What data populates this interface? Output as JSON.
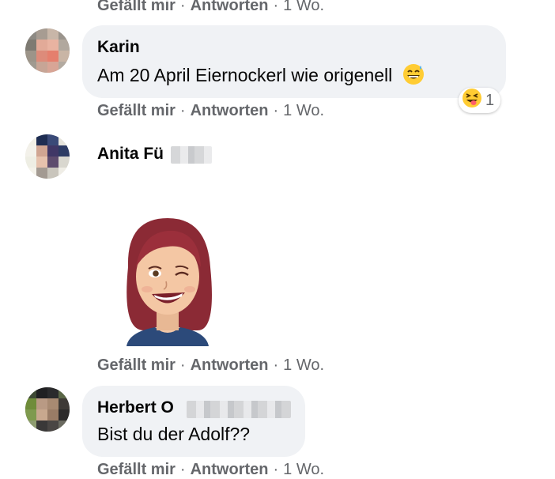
{
  "top_actions": {
    "like": "Gefällt mir",
    "reply": "Antworten",
    "time": "1 Wo."
  },
  "comments": [
    {
      "author": "Karin",
      "text": "Am 20 April Eiernockerl wie origenell",
      "emoji_icon": "grinning-sweat-icon",
      "reaction": {
        "icon": "squinting-tongue-face-icon",
        "count": "1"
      },
      "actions": {
        "like": "Gefällt mir",
        "reply": "Antworten",
        "time": "1 Wo."
      }
    },
    {
      "author": "Anita Fü",
      "sticker_icon": "avatar-wink-sticker-icon",
      "actions": {
        "like": "Gefällt mir",
        "reply": "Antworten",
        "time": "1 Wo."
      }
    },
    {
      "author": "Herbert O",
      "text": "Bist du der Adolf??",
      "actions": {
        "like": "Gefällt mir",
        "reply": "Antworten",
        "time": "1 Wo."
      }
    }
  ],
  "colors": {
    "bubble": "#f0f2f5",
    "meta_text": "#65676b",
    "text": "#050505"
  }
}
